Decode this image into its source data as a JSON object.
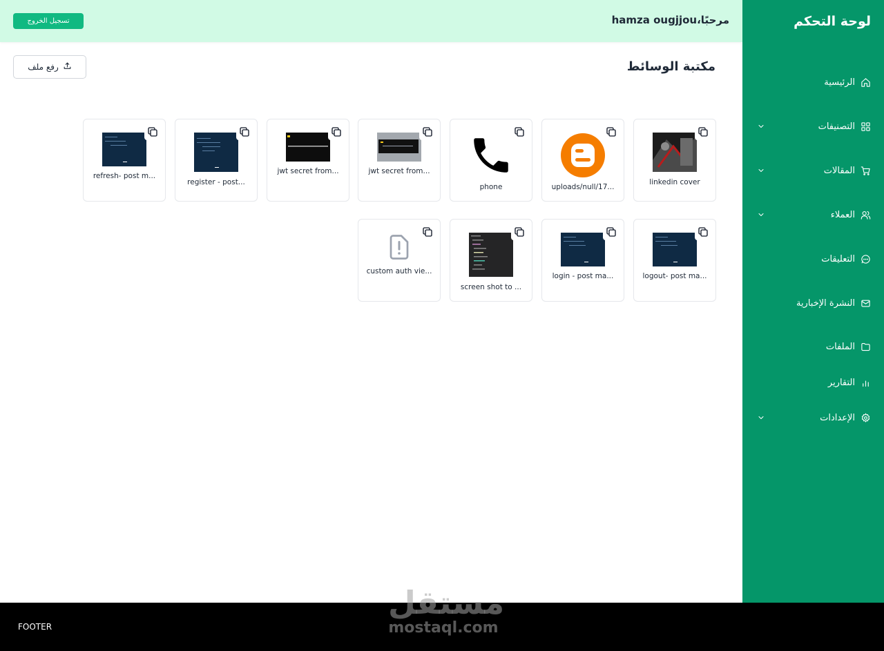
{
  "header": {
    "greeting": "مرحبًا،hamza ougjjou",
    "logout_label": "تسجيل الخروج"
  },
  "sidebar": {
    "title": "لوحة التحكم",
    "items": [
      {
        "label": "الرئيسية",
        "icon": "home-icon",
        "has_chevron": false
      },
      {
        "label": "التصنيفات",
        "icon": "grid-icon",
        "has_chevron": true
      },
      {
        "label": "المقالات",
        "icon": "cart-icon",
        "has_chevron": true
      },
      {
        "label": "العملاء",
        "icon": "users-icon",
        "has_chevron": true
      },
      {
        "label": "التعليقات",
        "icon": "message-icon",
        "has_chevron": false
      },
      {
        "label": "النشرة الإخبارية",
        "icon": "mail-icon",
        "has_chevron": false
      },
      {
        "label": "الملفات",
        "icon": "folder-icon",
        "has_chevron": false
      },
      {
        "label": "التقارير",
        "icon": "chart-icon",
        "has_chevron": false
      },
      {
        "label": "الإعدادات",
        "icon": "gear-icon",
        "has_chevron": true
      }
    ]
  },
  "main": {
    "title": "مكتبة الوسائط",
    "upload_label": "رفع ملف",
    "files": [
      {
        "name": "linkedin cover",
        "thumb": "photo"
      },
      {
        "name": "uploads/null/17...",
        "thumb": "blogger-logo"
      },
      {
        "name": "phone",
        "thumb": "phone-icon"
      },
      {
        "name": "jwt secret from...",
        "thumb": "terminal-gray"
      },
      {
        "name": "jwt secret from...",
        "thumb": "terminal-dark"
      },
      {
        "name": "register - post...",
        "thumb": "code-screenshot"
      },
      {
        "name": "refresh- post m...",
        "thumb": "code-screenshot"
      },
      {
        "name": "logout- post ma...",
        "thumb": "code-screenshot"
      },
      {
        "name": "login - post ma...",
        "thumb": "code-screenshot"
      },
      {
        "name": "screen shot to ...",
        "thumb": "file-tree"
      },
      {
        "name": "custom auth vie...",
        "thumb": "file-alert-icon"
      }
    ]
  },
  "footer": {
    "text": "FOOTER",
    "watermark_ar": "مستقل",
    "watermark_en": "mostaql.com"
  },
  "colors": {
    "sidebar": "#059669",
    "header": "#d1fae5",
    "accent_button": "#10b981",
    "footer": "#000000"
  }
}
